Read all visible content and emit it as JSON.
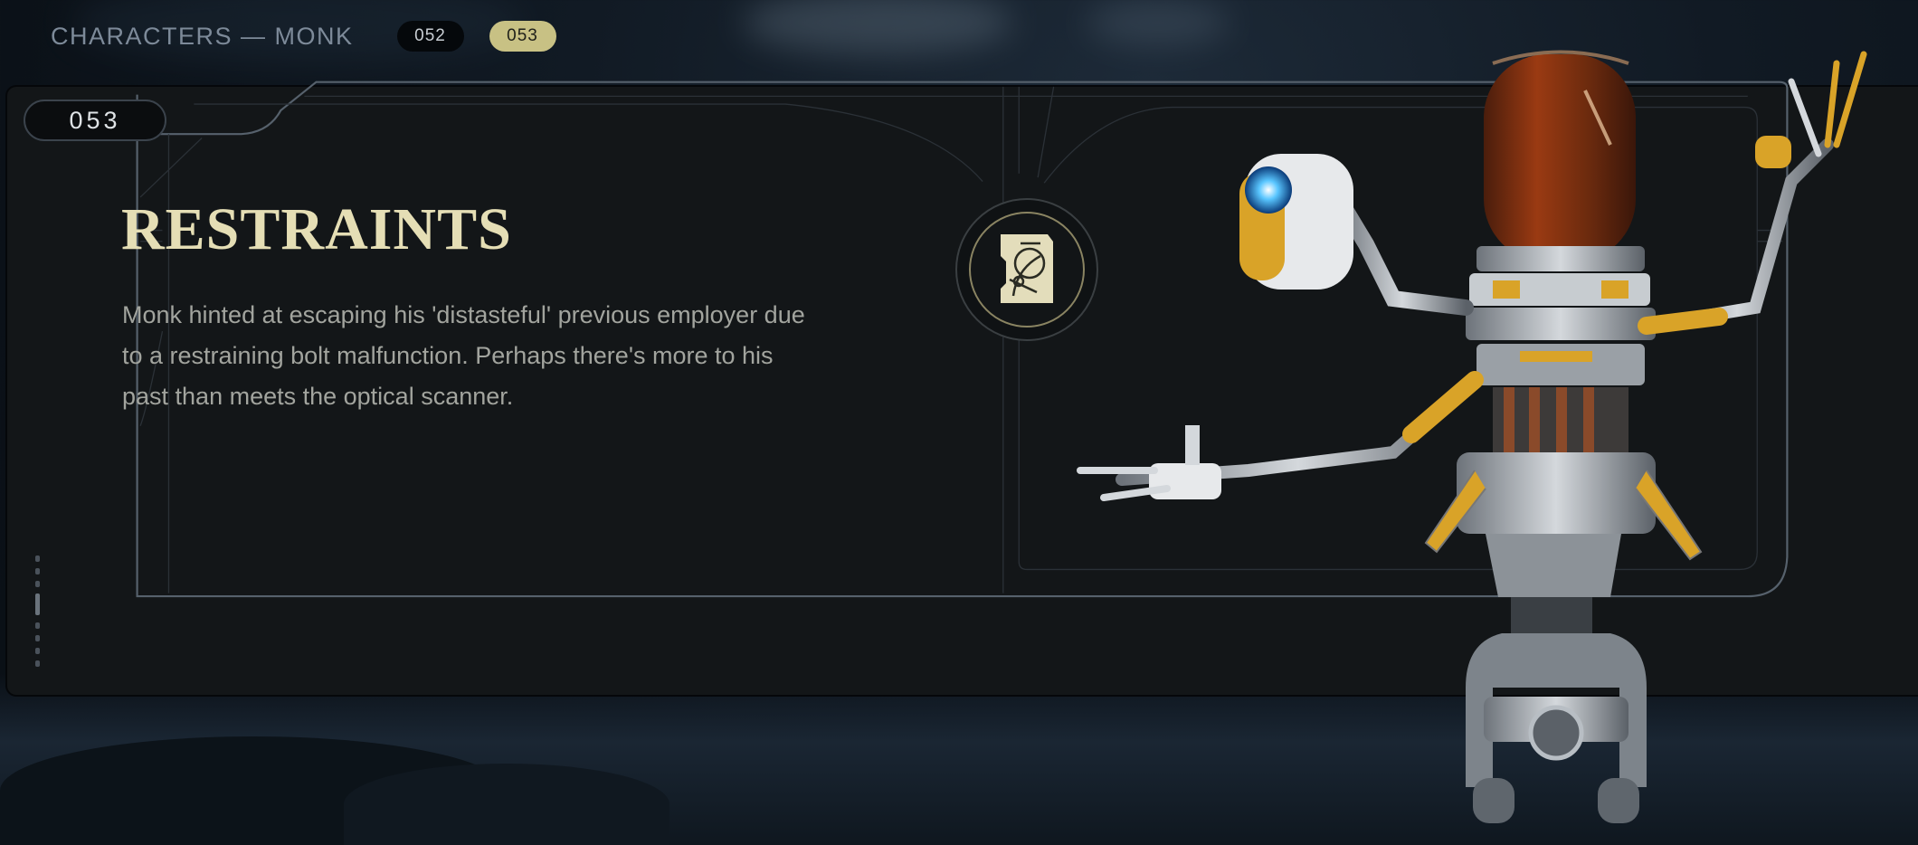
{
  "breadcrumb": "CHARACTERS — MONK",
  "entries": [
    {
      "label": "052",
      "active": false
    },
    {
      "label": "053",
      "active": true
    }
  ],
  "entry": {
    "number": "053",
    "title": "RESTRAINTS",
    "description": "Monk hinted at escaping his 'distasteful' previous employer due to a restraining bolt malfunction. Perhaps there's more to his past than meets the optical scanner.",
    "emblem_icon": "databank-glyph-icon"
  },
  "character_icon": "monk-droid-render",
  "colors": {
    "title": "#e5deb5",
    "accent_pill": "#c8c184",
    "panel_bg": "#131618",
    "frame_line": "#3b434c"
  }
}
